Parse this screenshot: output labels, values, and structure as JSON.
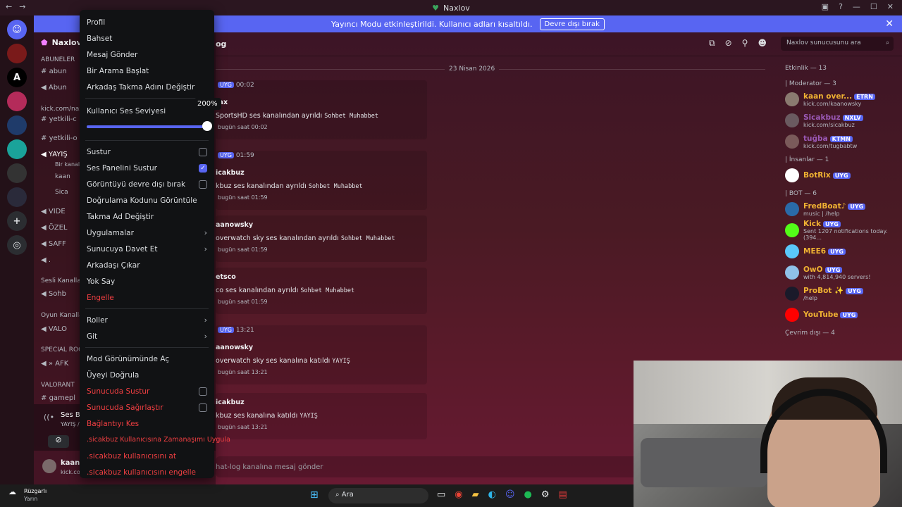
{
  "window": {
    "title": "Naxlov"
  },
  "banner": {
    "text": "Yayıncı Modu etkinleştirildi. Kullanıcı adları kısaltıldı.",
    "button": "Devre dışı bırak"
  },
  "server": {
    "name": "Naxlov",
    "search_placeholder": "Naxlov sunucusunu ara",
    "channel_suffix": "og"
  },
  "channels": {
    "categories": [
      "ABUNELER",
      "kick.com/nax",
      "Sesli Kanallar",
      "Oyun Kanalları",
      "SPECIAL ROOMS",
      "VALORANT"
    ],
    "items": [
      "abun",
      "Abun",
      "yetkili-c",
      "yetkili-o",
      "YAYIŞ",
      "Bir kanal d",
      "kaan",
      "Sica",
      "VIDE",
      "ÖZEL",
      "SAFF",
      ".",
      "Sohb",
      "VALO",
      "» AFK",
      "gamepl"
    ],
    "voice_status": "Ses Bağlantısı K",
    "voice_sub": "YAYIŞ / Naxlov",
    "user_name": "kaan",
    "user_sub": "kick.co..."
  },
  "menu": {
    "items_top": [
      "Profil",
      "Bahset",
      "Mesaj Gönder",
      "Bir Arama Başlat",
      "Arkadaş Takma Adını Değiştir"
    ],
    "volume_label": "Kullanıcı Ses Seviyesi",
    "volume_value": "200%",
    "volume_fraction": 1.0,
    "checks": [
      {
        "label": "Sustur",
        "checked": false
      },
      {
        "label": "Ses Panelini Sustur",
        "checked": true
      },
      {
        "label": "Görüntüyü devre dışı bırak",
        "checked": false
      }
    ],
    "items_mid": [
      "Doğrulama Kodunu Görüntüle",
      "Takma Ad Değiştir"
    ],
    "items_arrow": [
      "Uygulamalar",
      "Sunucuya Davet Et"
    ],
    "items_mid2": [
      "Arkadaşı Çıkar",
      "Yok Say"
    ],
    "block": "Engelle",
    "items_arrow2": [
      "Roller",
      "Git"
    ],
    "items_mod": [
      "Mod Görünümünde Aç",
      "Üyeyi Doğrula"
    ],
    "danger_checks": [
      "Sunucuda Sustur",
      "Sunucuda Sağırlaştır"
    ],
    "danger_items": [
      "Bağlantıyı Kes",
      ".sicakbuz Kullanıcısına Zamanaşımı Uygula",
      ".sicakbuz kullanıcısını at",
      ".sicakbuz kullanıcısını engelle"
    ]
  },
  "chat": {
    "date": "23 Nisan 2026",
    "input_placeholder": "hat-log kanalına mesaj gönder",
    "messages": [
      {
        "time": "00:02",
        "user": "tax",
        "line": "SportsHD ses kanalından ayrıldı",
        "channel": "Sohbet Muhabbet",
        "stamp": "bugün saat 00:02"
      },
      {
        "time": "01:59",
        "user": "icakbuz",
        "line": "kbuz ses kanalından ayrıldı",
        "channel": "Sohbet Muhabbet",
        "stamp": "bugün saat 01:59"
      },
      {
        "time": "",
        "user": "aanowsky",
        "line": "overwatch sky ses kanalından ayrıldı",
        "channel": "Sohbet Muhabbet",
        "stamp": "bugün saat 01:59"
      },
      {
        "time": "",
        "user": "etsco",
        "line": "co ses kanalından ayrıldı",
        "channel": "Sohbet Muhabbet",
        "stamp": "bugün saat 01:59"
      },
      {
        "time": "13:21",
        "user": "aanowsky",
        "line": "overwatch sky ses kanalına katıldı",
        "channel": "YAYIŞ",
        "stamp": "bugün saat 13:21"
      },
      {
        "time": "",
        "user": "icakbuz",
        "line": "kbuz ses kanalına katıldı",
        "channel": "YAYIŞ",
        "stamp": "bugün saat 13:21"
      }
    ],
    "app_tag": "UYG"
  },
  "members": {
    "activity": "Etkinlik — 13",
    "groups": [
      {
        "title": "| Moderator — 3",
        "list": [
          {
            "name": "kaan over...",
            "tag": "ETRN",
            "sub": "kick.com/kaanowsky",
            "color": "#f0b232"
          },
          {
            "name": "Sicakbuz",
            "tag": "NXLV",
            "sub": "kick.com/sicakbuz",
            "color": "#9b59b6"
          },
          {
            "name": "tuğba",
            "tag": "KTMN",
            "sub": "kick.com/tugbabtw",
            "color": "#9b59b6"
          }
        ]
      },
      {
        "title": "| İnsanlar — 1",
        "list": [
          {
            "name": "BotRix",
            "tag": "UYG",
            "sub": "",
            "color": "#f0b232"
          }
        ]
      },
      {
        "title": "| BOT — 6",
        "list": [
          {
            "name": "FredBoat♪",
            "tag": "UYG",
            "sub": "music | /help",
            "color": "#f0b232"
          },
          {
            "name": "Kick",
            "tag": "UYG",
            "sub": "Sent 1207 notifications today. (394...",
            "color": "#f0b232"
          },
          {
            "name": "MEE6",
            "tag": "UYG",
            "sub": "",
            "color": "#f0b232"
          },
          {
            "name": "OwO",
            "tag": "UYG",
            "sub": "with 4,814,940 servers!",
            "color": "#f0b232"
          },
          {
            "name": "ProBot ✨",
            "tag": "UYG",
            "sub": "/help",
            "color": "#f0b232"
          },
          {
            "name": "YouTube",
            "tag": "UYG",
            "sub": "",
            "color": "#f0b232"
          }
        ]
      }
    ],
    "offline": "Çevrim dışı — 4"
  },
  "taskbar": {
    "weather": "Rüzgarlı",
    "weather_sub": "Yarın",
    "search": "Ara"
  }
}
